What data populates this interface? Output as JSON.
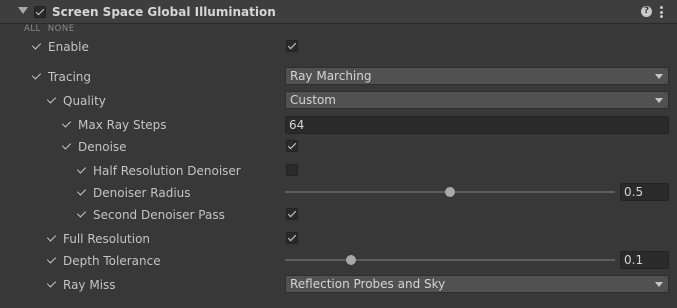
{
  "header": {
    "title": "Screen Space Global Illumination",
    "help_glyph": "?",
    "help_icon": "help-icon",
    "menu_icon": "kebab-menu-icon"
  },
  "override_links": {
    "all": "ALL",
    "none": "NONE"
  },
  "settings": {
    "enable": {
      "label": "Enable",
      "checked": true
    },
    "tracing": {
      "label": "Tracing",
      "value": "Ray Marching"
    },
    "quality": {
      "label": "Quality",
      "value": "Custom"
    },
    "max_ray_steps": {
      "label": "Max Ray Steps",
      "value": "64"
    },
    "denoise": {
      "label": "Denoise",
      "checked": true
    },
    "half_resolution_denoiser": {
      "label": "Half Resolution Denoiser",
      "checked": false
    },
    "denoiser_radius": {
      "label": "Denoiser Radius",
      "value": "0.5",
      "slider_fraction": 0.5
    },
    "second_denoiser_pass": {
      "label": "Second Denoiser Pass",
      "checked": true
    },
    "full_resolution": {
      "label": "Full Resolution",
      "checked": true
    },
    "depth_tolerance": {
      "label": "Depth Tolerance",
      "value": "0.1",
      "slider_fraction": 0.2
    },
    "ray_miss": {
      "label": "Ray Miss",
      "value": "Reflection Probes and Sky"
    }
  }
}
